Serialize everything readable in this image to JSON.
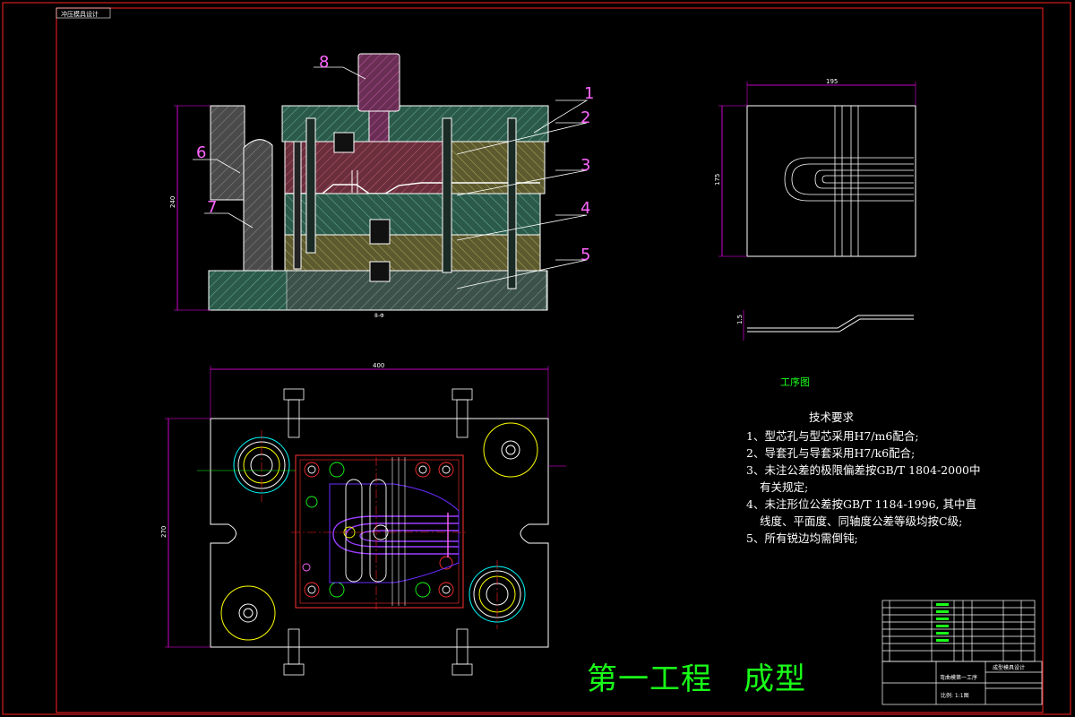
{
  "drawing": {
    "corner_tag": "冲压模具设计",
    "title_big": "第一工程　成型",
    "process_label": "工序图",
    "part_labels": [
      "1",
      "2",
      "3",
      "4",
      "5",
      "6",
      "7",
      "8"
    ],
    "dims": {
      "front_height": "240",
      "front_foot": "8-Φ",
      "plan_width": "400",
      "plan_height": "270",
      "part_width": "195",
      "part_height": "175",
      "thickness": "1.5"
    },
    "notes": {
      "title": "技术要求",
      "items": [
        "1、型芯孔与型芯采用H7/m6配合;",
        "2、导套孔与导套采用H7/k6配合;",
        "3、未注公差的极限偏差按GB/T 1804-2000中",
        "有关规定;",
        "4、未注形位公差按GB/T 1184-1996, 其中直",
        "线度、平面度、同轴度公差等级均按C级;",
        "5、所有锐边均需倒钝;"
      ]
    },
    "title_block": {
      "drawing_name": "弯曲模第一工序",
      "school": "成型模具设计",
      "scale_note": "比例: 1:1图"
    },
    "colors": {
      "background": "#000000",
      "outline": "#ffffff",
      "hatch": "#c8c8c8",
      "dimension": "#ff00ff",
      "centerline": "#ff2020",
      "accent_green": "#19ff19",
      "part_purple": "#9a3cff",
      "yellow": "#ffff00",
      "cyan": "#00ffff"
    }
  }
}
